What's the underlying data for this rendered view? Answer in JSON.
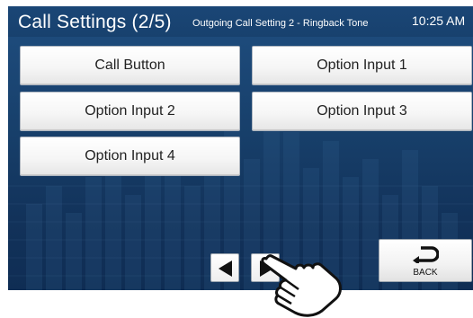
{
  "header": {
    "title": "Call Settings (2/5)",
    "subtitle": "Outgoing Call Setting 2 - Ringback Tone",
    "time": "10:25 AM"
  },
  "buttons": {
    "call_button": "Call Button",
    "option_input_1": "Option Input 1",
    "option_input_2": "Option Input 2",
    "option_input_3": "Option Input 3",
    "option_input_4": "Option Input 4"
  },
  "navigation": {
    "prev_icon": "triangle-left-icon",
    "next_icon": "triangle-right-icon"
  },
  "back": {
    "label": "BACK",
    "icon": "return-arrow-icon"
  },
  "pointer": {
    "icon": "pointing-hand-icon"
  },
  "colors": {
    "screen_bg": "#173f6a",
    "header_bg": "#1a4676",
    "button_face": "#f6f6f6",
    "text": "#222222"
  }
}
